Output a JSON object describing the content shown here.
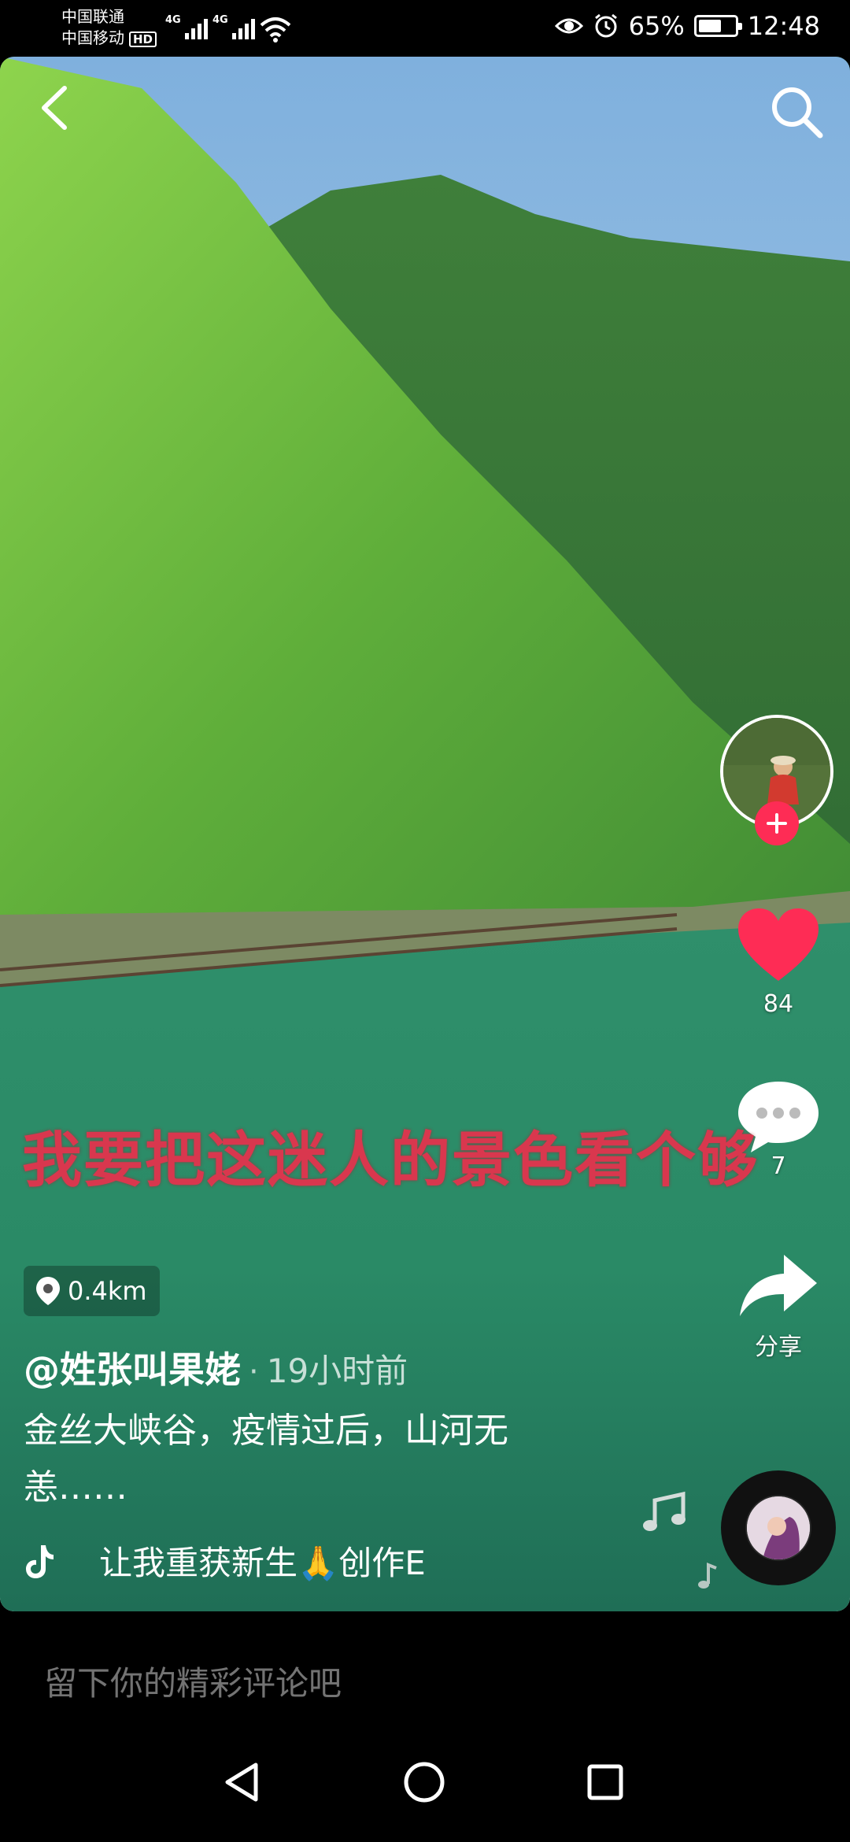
{
  "status_bar": {
    "carrier_1": "中国联通",
    "carrier_2": "中国移动",
    "hd_badge": "HD",
    "network_1": "4G",
    "network_2": "4G",
    "battery_text": "65%",
    "battery_level": 0.65,
    "time": "12:48",
    "icons": [
      "signal-icon",
      "wifi-icon",
      "eye-icon",
      "alarm-icon",
      "battery-icon"
    ]
  },
  "video": {
    "overlay_caption": "我要把这迷人的景色看个够",
    "location": "0.4km",
    "author": "@姓张叫果姥",
    "separator": "·",
    "posted_time": "19小时前",
    "description": "金丝大峡谷，疫情过后，山河无恙……",
    "music_title": "让我重获新生🙏创作E"
  },
  "actions": {
    "like_count": "84",
    "comment_count": "7",
    "share_label": "分享"
  },
  "comment_bar": {
    "placeholder": "留下你的精彩评论吧"
  },
  "colors": {
    "accent_red": "#fe2c55",
    "caption_red": "#e3334d",
    "background": "#000000"
  }
}
